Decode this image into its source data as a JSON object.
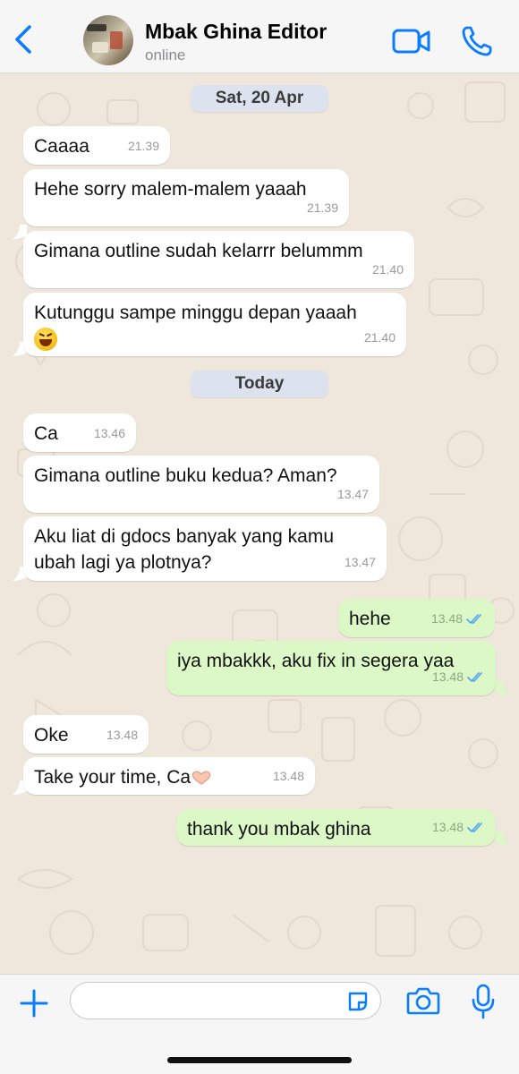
{
  "header": {
    "back_icon": "chevron-left-icon",
    "contact_name": "Mbak Ghina Editor",
    "status": "online",
    "video_icon": "video-camera-icon",
    "call_icon": "phone-icon",
    "accent": "#0a7cff"
  },
  "chat": {
    "dates": [
      "Sat, 20 Apr",
      "Today"
    ],
    "messages": [
      {
        "dir": "in",
        "text": "Caaaa",
        "time": "21.39"
      },
      {
        "dir": "in",
        "text": "Hehe sorry malem-malem yaaah",
        "time": "21.39"
      },
      {
        "dir": "in",
        "text": "Gimana outline sudah kelarrr belummm",
        "time": "21.40"
      },
      {
        "dir": "in",
        "text": "Kutunggu sampe minggu depan yaaah",
        "time": "21.40",
        "emoji": "grinning-squinting-face"
      },
      {
        "dir": "in",
        "text": "Ca",
        "time": "13.46"
      },
      {
        "dir": "in",
        "text": "Gimana outline buku kedua? Aman?",
        "time": "13.47"
      },
      {
        "dir": "in",
        "text": "Aku liat di gdocs banyak yang kamu",
        "text2": "ubah lagi ya plotnya?",
        "time": "13.47"
      },
      {
        "dir": "out",
        "text": "hehe",
        "time": "13.48",
        "status": "read"
      },
      {
        "dir": "out",
        "text": "iya mbakkk, aku fix in segera yaa",
        "time": "13.48",
        "status": "read"
      },
      {
        "dir": "in",
        "text": "Oke",
        "time": "13.48"
      },
      {
        "dir": "in",
        "text": "Take your time, Ca",
        "time": "13.48",
        "emoji": "heart-hands"
      },
      {
        "dir": "out",
        "text": "thank you mbak ghina",
        "time": "13.48",
        "status": "read"
      }
    ],
    "bubble_in_color": "#ffffff",
    "bubble_out_color": "#dcf8c6",
    "read_tick_color": "#4fa3f7"
  },
  "composer": {
    "plus_icon": "plus-icon",
    "input_value": "",
    "sticker_icon": "sticker-icon",
    "camera_icon": "camera-icon",
    "mic_icon": "microphone-icon"
  }
}
